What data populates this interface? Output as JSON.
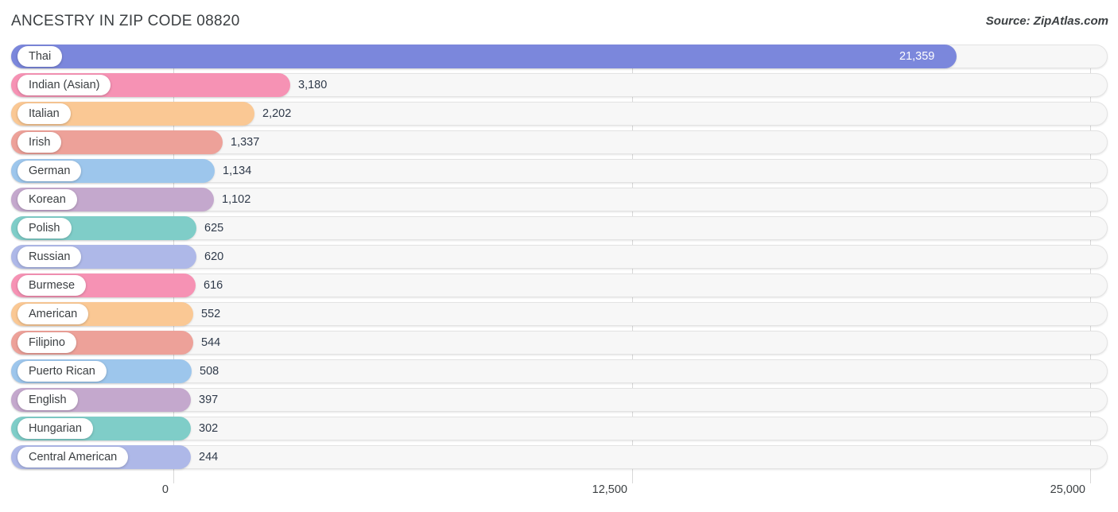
{
  "header": {
    "title": "ANCESTRY IN ZIP CODE 08820",
    "source": "Source: ZipAtlas.com"
  },
  "chart_data": {
    "type": "bar",
    "orientation": "horizontal",
    "title": "ANCESTRY IN ZIP CODE 08820",
    "xlabel": "",
    "ylabel": "",
    "xlim": [
      0,
      25000
    ],
    "grid": true,
    "legend": "none",
    "xticks": [
      "0",
      "12,500",
      "25,000"
    ],
    "xtick_values": [
      0,
      12500,
      25000
    ],
    "categories": [
      "Thai",
      "Indian (Asian)",
      "Italian",
      "Irish",
      "German",
      "Korean",
      "Polish",
      "Russian",
      "Burmese",
      "American",
      "Filipino",
      "Puerto Rican",
      "English",
      "Hungarian",
      "Central American"
    ],
    "values": [
      21359,
      3180,
      2202,
      1337,
      1134,
      1102,
      625,
      620,
      616,
      552,
      544,
      508,
      397,
      302,
      244
    ],
    "value_labels": [
      "21,359",
      "3,180",
      "2,202",
      "1,337",
      "1,134",
      "1,102",
      "625",
      "620",
      "616",
      "552",
      "544",
      "508",
      "397",
      "302",
      "244"
    ],
    "colors": [
      "#7b87dc",
      "#f692b4",
      "#fac894",
      "#eda199",
      "#9dc6ec",
      "#c4a8cd",
      "#7fcdc8",
      "#aeb8e8",
      "#f692b4",
      "#fac894",
      "#eda199",
      "#9dc6ec",
      "#c4a8cd",
      "#7fcdc8",
      "#aeb8e8"
    ],
    "track_color": "#f7f7f7",
    "gridline_color": "#d8d8d8"
  }
}
